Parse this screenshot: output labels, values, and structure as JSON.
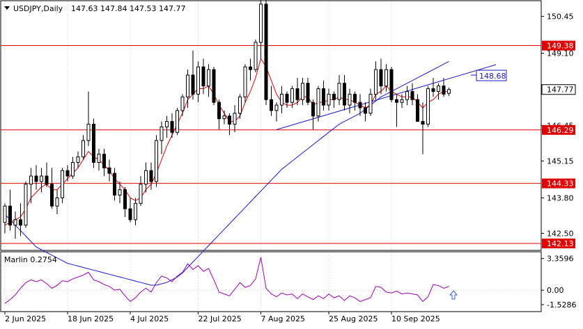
{
  "header": {
    "symbol_label": "USDJPY,Daily",
    "ohlc_label": "147.63 147.84 147.53 147.77"
  },
  "indicator": {
    "label": "Marlin 0.2754",
    "axis_ticks": [
      "3.3596",
      "0.00",
      "-1.5286"
    ],
    "color": "#9a00b0"
  },
  "price_axis": {
    "ticks": [
      "150.45",
      "149.10",
      "147.77",
      "146.45",
      "145.15",
      "143.80",
      "142.50"
    ]
  },
  "levels": [
    {
      "label": "149.38",
      "value": 149.38,
      "color": "#e00000"
    },
    {
      "label": "146.29",
      "value": 146.29,
      "color": "#e00000"
    },
    {
      "label": "144.33",
      "value": 144.33,
      "color": "#e00000"
    },
    {
      "label": "142.13",
      "value": 142.13,
      "color": "#e00000"
    }
  ],
  "current_price_label": "147.77",
  "target_label": "148.68",
  "x_ticks": [
    "2 Jun 2025",
    "18 Jun 2025",
    "4 Jul 2025",
    "22 Jul 2025",
    "7 Aug 2025",
    "25 Aug 2025",
    "10 Sep 2025"
  ],
  "colors": {
    "fast_ma": "#e00000",
    "slow_ma": "#1a1acd",
    "candle": "#000000",
    "level": "#e00000",
    "target_box": "#1a1acd",
    "arrow": "#3a5fd0"
  },
  "chart_data": {
    "type": "candlestick",
    "title": "USDJPY,Daily",
    "ylim": [
      141.9,
      151.0
    ],
    "candles": [
      [
        142.9,
        143.6,
        142.5,
        143.5
      ],
      [
        143.5,
        144.1,
        142.6,
        142.8
      ],
      [
        142.8,
        143.3,
        142.3,
        143.0
      ],
      [
        143.0,
        143.6,
        142.4,
        142.8
      ],
      [
        142.8,
        144.4,
        142.7,
        144.3
      ],
      [
        144.3,
        144.9,
        143.6,
        144.6
      ],
      [
        144.6,
        145.0,
        144.1,
        144.4
      ],
      [
        144.4,
        144.9,
        144.0,
        144.6
      ],
      [
        144.6,
        145.1,
        144.2,
        144.3
      ],
      [
        144.3,
        144.9,
        143.4,
        143.5
      ],
      [
        143.5,
        144.1,
        143.2,
        143.8
      ],
      [
        143.8,
        144.9,
        143.6,
        144.8
      ],
      [
        144.8,
        145.0,
        144.4,
        144.6
      ],
      [
        144.6,
        145.3,
        144.5,
        145.1
      ],
      [
        145.1,
        145.5,
        144.9,
        145.3
      ],
      [
        145.3,
        146.1,
        145.2,
        145.9
      ],
      [
        145.9,
        147.7,
        145.7,
        146.5
      ],
      [
        146.5,
        146.7,
        144.9,
        145.1
      ],
      [
        145.1,
        145.6,
        144.8,
        145.4
      ],
      [
        145.4,
        145.6,
        144.6,
        144.9
      ],
      [
        144.9,
        145.2,
        144.4,
        144.7
      ],
      [
        144.7,
        144.9,
        143.7,
        143.9
      ],
      [
        143.9,
        144.4,
        143.6,
        144.1
      ],
      [
        144.1,
        144.2,
        143.1,
        143.4
      ],
      [
        143.4,
        143.8,
        142.9,
        143.0
      ],
      [
        143.0,
        143.8,
        142.8,
        143.6
      ],
      [
        143.6,
        144.6,
        143.5,
        144.3
      ],
      [
        144.3,
        145.1,
        144.0,
        144.8
      ],
      [
        144.8,
        145.1,
        144.1,
        144.4
      ],
      [
        144.4,
        146.1,
        144.2,
        145.9
      ],
      [
        145.9,
        146.6,
        145.4,
        146.4
      ],
      [
        146.4,
        146.8,
        146.0,
        146.6
      ],
      [
        146.6,
        146.9,
        146.0,
        146.2
      ],
      [
        146.2,
        147.1,
        146.1,
        147.0
      ],
      [
        147.0,
        147.6,
        146.8,
        147.5
      ],
      [
        147.5,
        148.5,
        147.1,
        148.3
      ],
      [
        148.3,
        149.2,
        147.4,
        147.6
      ],
      [
        147.6,
        148.8,
        147.3,
        148.6
      ],
      [
        148.6,
        148.9,
        147.6,
        147.9
      ],
      [
        147.9,
        148.7,
        147.5,
        148.5
      ],
      [
        148.5,
        148.6,
        147.2,
        147.3
      ],
      [
        147.3,
        147.4,
        146.3,
        146.7
      ],
      [
        146.7,
        147.0,
        146.5,
        146.8
      ],
      [
        146.8,
        146.9,
        146.1,
        146.5
      ],
      [
        146.5,
        147.2,
        146.2,
        146.9
      ],
      [
        146.9,
        147.6,
        146.7,
        147.5
      ],
      [
        147.5,
        148.7,
        147.3,
        148.6
      ],
      [
        148.6,
        148.9,
        148.1,
        148.5
      ],
      [
        148.5,
        149.6,
        148.4,
        149.5
      ],
      [
        149.5,
        151.2,
        148.9,
        150.9
      ],
      [
        150.9,
        151.1,
        147.2,
        147.4
      ],
      [
        147.4,
        147.9,
        146.8,
        147.0
      ],
      [
        147.0,
        147.3,
        146.6,
        147.2
      ],
      [
        147.2,
        147.9,
        146.9,
        147.6
      ],
      [
        147.6,
        147.7,
        147.1,
        147.3
      ],
      [
        147.3,
        147.9,
        147.1,
        147.8
      ],
      [
        147.8,
        148.2,
        147.2,
        147.4
      ],
      [
        147.4,
        148.2,
        147.2,
        148.0
      ],
      [
        148.0,
        148.2,
        147.2,
        147.3
      ],
      [
        147.3,
        147.4,
        146.3,
        146.8
      ],
      [
        146.8,
        147.9,
        146.6,
        147.8
      ],
      [
        147.8,
        148.1,
        147.0,
        147.2
      ],
      [
        147.2,
        147.8,
        147.0,
        147.6
      ],
      [
        147.6,
        147.7,
        147.1,
        147.4
      ],
      [
        147.4,
        148.3,
        147.2,
        148.0
      ],
      [
        148.0,
        148.3,
        147.0,
        147.2
      ],
      [
        147.2,
        147.8,
        146.9,
        147.6
      ],
      [
        147.6,
        147.7,
        147.0,
        147.3
      ],
      [
        147.3,
        147.6,
        146.8,
        147.1
      ],
      [
        147.1,
        147.3,
        146.6,
        146.9
      ],
      [
        146.9,
        147.8,
        146.8,
        147.6
      ],
      [
        147.6,
        148.8,
        147.4,
        148.5
      ],
      [
        148.5,
        148.9,
        147.6,
        147.9
      ],
      [
        147.9,
        148.7,
        147.7,
        148.5
      ],
      [
        148.5,
        148.6,
        147.3,
        147.4
      ],
      [
        147.4,
        147.6,
        146.4,
        147.3
      ],
      [
        147.3,
        147.6,
        147.1,
        147.4
      ],
      [
        147.4,
        147.9,
        147.2,
        147.7
      ],
      [
        147.7,
        148.0,
        147.2,
        147.4
      ],
      [
        147.4,
        147.6,
        146.6,
        146.6
      ],
      [
        146.6,
        147.3,
        145.4,
        146.5
      ],
      [
        146.5,
        147.9,
        146.4,
        147.8
      ],
      [
        147.8,
        148.2,
        147.5,
        147.7
      ],
      [
        147.7,
        148.0,
        147.4,
        147.9
      ],
      [
        147.9,
        148.2,
        147.5,
        147.6
      ],
      [
        147.63,
        147.84,
        147.53,
        147.77
      ]
    ],
    "fast_ma": [
      142.8,
      142.9,
      143.0,
      143.1,
      143.4,
      143.8,
      144.0,
      144.2,
      144.3,
      144.1,
      144.1,
      144.3,
      144.5,
      144.7,
      144.9,
      145.2,
      145.5,
      145.3,
      145.2,
      145.0,
      144.8,
      144.5,
      144.3,
      144.1,
      143.8,
      143.7,
      143.8,
      144.1,
      144.3,
      144.7,
      145.2,
      145.7,
      146.1,
      146.5,
      146.9,
      147.4,
      147.6,
      147.8,
      147.8,
      147.9,
      147.6,
      147.2,
      146.9,
      146.6,
      146.6,
      146.8,
      147.3,
      147.7,
      148.2,
      148.9,
      148.6,
      148.1,
      147.6,
      147.3,
      147.2,
      147.2,
      147.3,
      147.5,
      147.5,
      147.2,
      147.3,
      147.3,
      147.4,
      147.4,
      147.5,
      147.4,
      147.4,
      147.3,
      147.2,
      147.1,
      147.2,
      147.6,
      147.7,
      147.9,
      147.7,
      147.6,
      147.5,
      147.5,
      147.5,
      147.3,
      147.1,
      147.3,
      147.4,
      147.6,
      147.7,
      147.7
    ],
    "slow_ma": [
      143.2,
      143.0,
      142.8,
      142.6,
      142.4,
      142.2,
      142.0,
      141.9,
      141.8,
      141.7,
      141.6,
      141.5,
      141.4,
      141.35,
      141.3,
      141.25,
      141.2,
      141.15,
      141.1,
      141.05,
      141.0,
      140.95,
      140.9,
      140.85,
      140.8,
      140.75,
      140.7,
      140.65,
      140.6,
      140.6,
      140.65,
      140.7,
      140.8,
      140.9,
      141.05,
      141.25,
      141.45,
      141.65,
      141.85,
      142.05,
      142.25,
      142.45,
      142.65,
      142.85,
      143.05,
      143.25,
      143.45,
      143.65,
      143.85,
      144.05,
      144.25,
      144.45,
      144.65,
      144.85,
      145.0,
      145.15,
      145.3,
      145.45,
      145.6,
      145.75,
      145.9,
      146.05,
      146.2,
      146.35,
      146.5,
      146.6,
      146.7,
      146.8,
      146.9,
      147.05,
      147.2,
      147.35,
      147.5,
      147.6,
      147.7,
      147.8,
      147.9,
      148.0,
      148.1,
      148.2,
      148.3,
      148.4,
      148.5,
      148.6,
      148.7,
      148.8
    ],
    "marlin": {
      "ylim": [
        -2.2,
        4.0
      ],
      "values": [
        -1.4,
        -1.0,
        -0.5,
        0.2,
        0.8,
        1.1,
        0.9,
        1.1,
        0.7,
        0.2,
        0.5,
        1.0,
        0.9,
        1.2,
        1.4,
        1.6,
        1.9,
        1.1,
        0.9,
        0.6,
        0.4,
        0.0,
        0.1,
        -0.6,
        -1.2,
        -0.8,
        -0.2,
        0.2,
        -0.2,
        0.8,
        1.5,
        1.3,
        0.9,
        1.5,
        1.9,
        2.8,
        2.2,
        2.6,
        2.0,
        2.3,
        1.1,
        -0.2,
        -0.4,
        -0.6,
        0.1,
        0.8,
        0.3,
        0.5,
        1.2,
        3.5,
        0.2,
        -0.4,
        -0.7,
        -0.3,
        -0.5,
        -0.4,
        -0.9,
        -0.4,
        -0.7,
        -1.0,
        -0.6,
        -0.9,
        -0.4,
        -0.8,
        -0.6,
        -1.1,
        -0.6,
        -0.8,
        -1.2,
        -1.0,
        -0.8,
        0.4,
        0.3,
        -0.2,
        -0.3,
        -0.1,
        -0.4,
        -0.3,
        -0.4,
        -0.5,
        -1.2,
        -0.7,
        0.6,
        0.5,
        0.2,
        0.4
      ]
    },
    "trendline": {
      "from_candle": 52,
      "from_value": 146.3,
      "to_candle": 94,
      "to_value": 148.68
    }
  }
}
